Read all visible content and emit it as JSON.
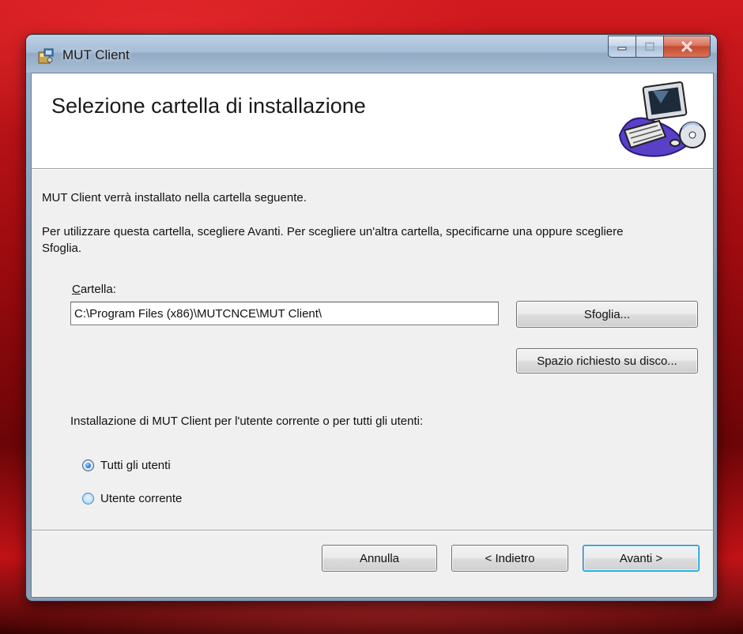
{
  "window": {
    "title": "MUT Client",
    "icon": "installer-icon",
    "caption_buttons": [
      "minimize-icon",
      "maximize-icon",
      "close-icon"
    ]
  },
  "header": {
    "title": "Selezione cartella di installazione",
    "graphic": "computer-cd-icon"
  },
  "body": {
    "intro": "MUT Client verrà installato nella cartella seguente.",
    "instructions": "Per utilizzare questa cartella, scegliere Avanti. Per scegliere un'altra cartella, specificarne una oppure scegliere Sfoglia.",
    "folder_label_accel": "C",
    "folder_label_rest": "artella:",
    "folder_value": "C:\\Program Files (x86)\\MUTCNCE\\MUT Client\\",
    "browse_label": "Sfoglia...",
    "disk_space_label": "Spazio richiesto su disco...",
    "scope_question": "Installazione di MUT Client per l'utente corrente o per tutti gli utenti:",
    "radio_all_users": "Tutti gli utenti",
    "radio_current_user": "Utente corrente",
    "selected_radio": "Tutti gli utenti"
  },
  "footer": {
    "cancel_label": "Annulla",
    "back_label": "< Indietro",
    "next_label": "Avanti >"
  },
  "colors": {
    "desktop": "#b01014",
    "client_bg": "#f0f0f0",
    "default_button_border": "#3c7fb1"
  }
}
